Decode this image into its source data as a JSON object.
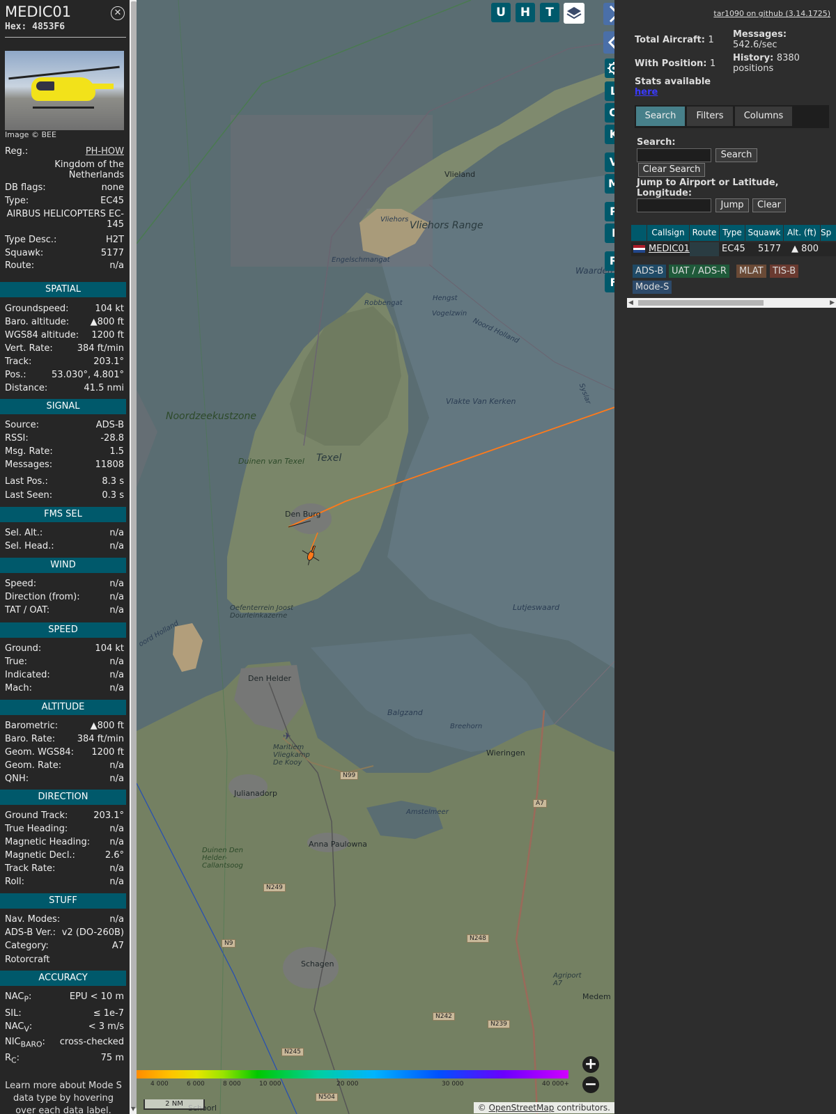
{
  "info": {
    "callsign": "MEDIC01",
    "hex_label": "Hex:",
    "hex": "4853F6",
    "close_icon": "close-icon",
    "image_credit": "Image © BEE",
    "fields": {
      "reg_label": "Reg.:",
      "reg": "PH-HOW",
      "country": "Kingdom of the Netherlands",
      "dbflags_label": "DB flags:",
      "dbflags": "none",
      "type_label": "Type:",
      "type": "EC45",
      "type_name": "AIRBUS HELICOPTERS EC-145",
      "typedesc_label": "Type Desc.:",
      "typedesc": "H2T",
      "squawk_label": "Squawk:",
      "squawk": "5177",
      "route_label": "Route:",
      "route": "n/a"
    },
    "spatial": {
      "title": "SPATIAL",
      "gs_label": "Groundspeed:",
      "gs": "104 kt",
      "baro_label": "Baro. altitude:",
      "baro": "▲800 ft",
      "wgs_label": "WGS84 altitude:",
      "wgs": "1200 ft",
      "vr_label": "Vert. Rate:",
      "vr": "384 ft/min",
      "track_label": "Track:",
      "track": "203.1°",
      "pos_label": "Pos.:",
      "pos": "53.030°, 4.801°",
      "dist_label": "Distance:",
      "dist": "41.5 nmi"
    },
    "signal": {
      "title": "SIGNAL",
      "source_label": "Source:",
      "source": "ADS-B",
      "rssi_label": "RSSI:",
      "rssi": "-28.8",
      "msgrate_label": "Msg. Rate:",
      "msgrate": "1.5",
      "messages_label": "Messages:",
      "messages": "11808",
      "lastpos_label": "Last Pos.:",
      "lastpos": "8.3 s",
      "lastseen_label": "Last Seen:",
      "lastseen": "0.3 s"
    },
    "fms": {
      "title": "FMS SEL",
      "alt_label": "Sel. Alt.:",
      "alt": "n/a",
      "head_label": "Sel. Head.:",
      "head": "n/a"
    },
    "wind": {
      "title": "WIND",
      "speed_label": "Speed:",
      "speed": "n/a",
      "dir_label": "Direction (from):",
      "dir": "n/a",
      "tat_label": "TAT / OAT:",
      "tat": "n/a"
    },
    "speed": {
      "title": "SPEED",
      "ground_label": "Ground:",
      "ground": "104 kt",
      "true_label": "True:",
      "true": "n/a",
      "ind_label": "Indicated:",
      "ind": "n/a",
      "mach_label": "Mach:",
      "mach": "n/a"
    },
    "altitude": {
      "title": "ALTITUDE",
      "baro_label": "Barometric:",
      "baro": "▲800 ft",
      "rate_label": "Baro. Rate:",
      "rate": "384 ft/min",
      "geom_label": "Geom. WGS84:",
      "geom": "1200 ft",
      "grate_label": "Geom. Rate:",
      "grate": "n/a",
      "qnh_label": "QNH:",
      "qnh": "n/a"
    },
    "direction": {
      "title": "DIRECTION",
      "gt_label": "Ground Track:",
      "gt": "203.1°",
      "th_label": "True Heading:",
      "th": "n/a",
      "mh_label": "Magnetic Heading:",
      "mh": "n/a",
      "md_label": "Magnetic Decl.:",
      "md": "2.6°",
      "tr_label": "Track Rate:",
      "tr": "n/a",
      "roll_label": "Roll:",
      "roll": "n/a"
    },
    "stuff": {
      "title": "STUFF",
      "nav_label": "Nav. Modes:",
      "nav": "n/a",
      "adsb_label": "ADS-B Ver.:",
      "adsb": "v2 (DO-260B)",
      "cat_label": "Category:",
      "cat": "A7",
      "cat_name": "Rotorcraft"
    },
    "accuracy": {
      "title": "ACCURACY",
      "nacp_label": "NAC",
      "nacp_sub": "P",
      "nacp": "EPU < 10 m",
      "sil_label": "SIL:",
      "sil": "≤ 1e-7",
      "nacv_label": "NAC",
      "nacv_sub": "V",
      "nacv": "< 3 m/s",
      "nicbaro_label": "NIC",
      "nicbaro_sub": "BARO",
      "nicbaro": "cross-checked",
      "rc_label": "R",
      "rc_sub": "C",
      "rc": "75 m"
    },
    "help": "Learn more about Mode S data type by hovering over each data label."
  },
  "map": {
    "toolbar_top": [
      "U",
      "H",
      "T"
    ],
    "toolbar_side": [
      "L",
      "O",
      "K",
      "V",
      "M",
      "P",
      "I",
      "R",
      "F"
    ],
    "labels": {
      "vlieland": "Vlieland",
      "vliehors": "Vliehors Range",
      "vliehors_small": "Vliehors",
      "engelschmangat": "Engelschmangat",
      "robbengat": "Robbengat",
      "hengst": "Hengst",
      "vogelzwin": "Vogelzwin",
      "noordholland": "Noord Holland",
      "vlakte": "Vlakte Van Kerken",
      "texel": "Texel",
      "duinen_texel": "Duinen van Texel",
      "noordzee": "Noordzeekustzone",
      "denburg": "Den Burg",
      "oefenterrein": "Oefenterrein Joost Dourleinkazerne",
      "lutjeswaard": "Lutjeswaard",
      "denhelder": "Den Helder",
      "balgzand": "Balgzand",
      "breehorn": "Breehorn",
      "wieringen": "Wieringen",
      "maritiem": "Maritiem Vliegkamp De Kooy",
      "julianadorp": "Julianadorp",
      "amstelmeer": "Amstelmeer",
      "annapaulowna": "Anna Paulowna",
      "duinen_helder": "Duinen Den Helder-Callantsoog",
      "schagen": "Schagen",
      "agriport": "Agriport A7",
      "medem": "Medem",
      "noordholland_left": "oord Holland",
      "waarden": "Waarden",
      "schoorl": "Schoorl",
      "syslar": "Syslar"
    },
    "roads": [
      "N99",
      "A7",
      "N249",
      "N9",
      "N248",
      "N242",
      "N239",
      "N245",
      "N504"
    ],
    "altitude_scale": [
      "4 000",
      "6 000",
      "8 000",
      "10 000",
      "20 000",
      "30 000",
      "40 000+"
    ],
    "scale_label": "2 NM",
    "attribution_prefix": "© ",
    "attribution_link": "OpenStreetMap",
    "attribution_suffix": " contributors."
  },
  "right": {
    "github": "tar1090 on github (3.14.1725)",
    "total_label": "Total Aircraft:",
    "total": "1",
    "withpos_label": "With Position:",
    "withpos": "1",
    "stats_label": "Stats available",
    "stats_link": "here",
    "messages_label": "Messages:",
    "messages": "542.6/sec",
    "history_label": "History:",
    "history": "8380 positions",
    "tabs": [
      "Search",
      "Filters",
      "Columns"
    ],
    "search_label": "Search:",
    "search_button": "Search",
    "clear_search": "Clear Search",
    "jump_label": "Jump to Airport or Latitude, Longitude:",
    "jump_button": "Jump",
    "clear_button": "Clear",
    "columns": [
      "Callsign",
      "Route",
      "Type",
      "Squawk",
      "Alt. (ft)",
      "Sp"
    ],
    "row": {
      "callsign": "MEDIC01",
      "type": "EC45",
      "squawk": "5177",
      "alt": "▲ 800"
    },
    "legend": [
      "ADS-B",
      "UAT / ADS-R",
      "MLAT",
      "TIS-B",
      "Mode-S"
    ],
    "legend_colors": [
      "#1f4a66",
      "#1f5a3a",
      "#6a4a36",
      "#6a3a30",
      "#2d4a6a"
    ]
  }
}
